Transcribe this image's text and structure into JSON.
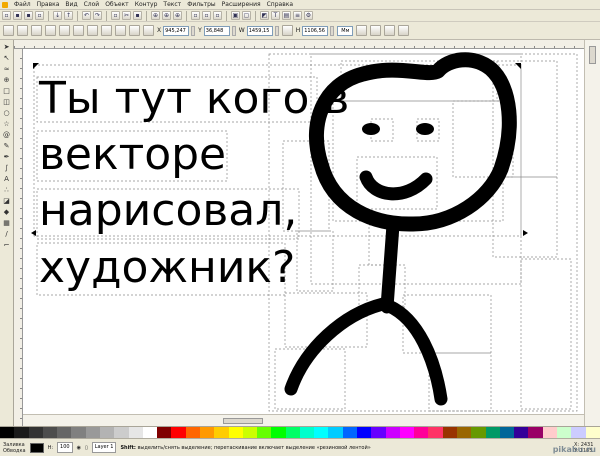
{
  "menu": [
    "Файл",
    "Правка",
    "Вид",
    "Слой",
    "Объект",
    "Контур",
    "Текст",
    "Фильтры",
    "Расширения",
    "Справка"
  ],
  "controls": {
    "x_label": "X",
    "x_value": "945,247",
    "y_label": "Y",
    "y_value": "36,848",
    "w_label": "W",
    "w_value": "1459,15",
    "h_label": "H",
    "h_value": "1106,56",
    "units": "Мм"
  },
  "canvas": {
    "text_lines": [
      "Ты тут кого в",
      "векторе",
      "нарисовал,",
      "художник?"
    ]
  },
  "status": {
    "fill_label": "Заливка",
    "stroke_label": "Обводка",
    "zoom_label": "Н:",
    "opacity_value": "100",
    "layer_name": "Layer 1",
    "message_bold": "Shift:",
    "message": " выделить/снять выделение; перетаскивание включает выделение «резиновой лентой»",
    "coord_x": "X: 2431",
    "coord_y": "Y: 1185"
  },
  "watermark": "pikabu.ru",
  "palette": [
    "#000000",
    "#1a1a1a",
    "#333333",
    "#4d4d4d",
    "#666666",
    "#808080",
    "#999999",
    "#b3b3b3",
    "#cccccc",
    "#e6e6e6",
    "#ffffff",
    "#800000",
    "#ff0000",
    "#ff6600",
    "#ff9900",
    "#ffcc00",
    "#ffff00",
    "#ccff00",
    "#66ff00",
    "#00ff00",
    "#00ff66",
    "#00ffcc",
    "#00ffff",
    "#00ccff",
    "#0066ff",
    "#0000ff",
    "#6600ff",
    "#cc00ff",
    "#ff00ff",
    "#ff0099",
    "#ff3366",
    "#993300",
    "#996600",
    "#669900",
    "#009966",
    "#006699",
    "#330099",
    "#990066",
    "#ffcccc",
    "#ccffcc",
    "#ccccff",
    "#ffffcc"
  ],
  "colors": {
    "chrome": "#ece9d8",
    "ink": "#000000",
    "selection_dash": "#808080"
  }
}
